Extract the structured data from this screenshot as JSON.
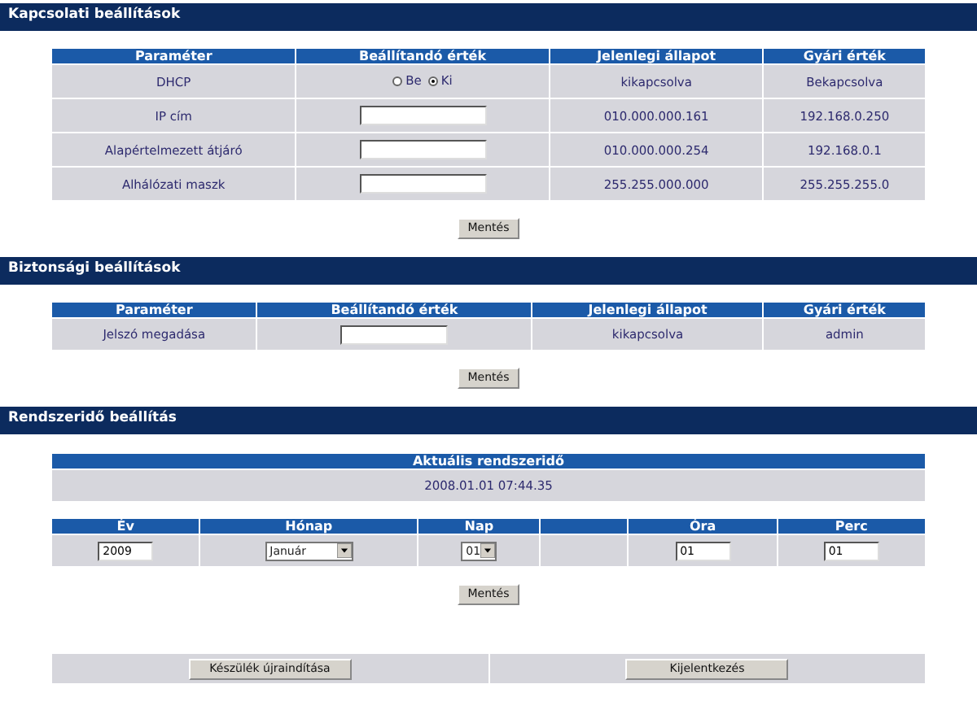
{
  "connection": {
    "title": "Kapcsolati beállítások",
    "columns": [
      "Paraméter",
      "Beállítandó érték",
      "Jelenlegi állapot",
      "Gyári érték"
    ],
    "rows": [
      {
        "parameter": "DHCP",
        "kind": "radio",
        "options": [
          {
            "label": "Be",
            "selected": false
          },
          {
            "label": "Ki",
            "selected": true
          }
        ],
        "current": "kikapcsolva",
        "factory": "Bekapcsolva"
      },
      {
        "parameter": "IP cím",
        "kind": "input",
        "current": "010.000.000.161",
        "factory": "192.168.0.250"
      },
      {
        "parameter": "Alapértelmezett átjáró",
        "kind": "input",
        "current": "010.000.000.254",
        "factory": "192.168.0.1"
      },
      {
        "parameter": "Alhálózati maszk",
        "kind": "input",
        "current": "255.255.000.000",
        "factory": "255.255.255.0"
      }
    ],
    "button": "Mentés"
  },
  "security": {
    "title": "Biztonsági beállítások",
    "columns": [
      "Paraméter",
      "Beállítandó érték",
      "Jelenlegi állapot",
      "Gyári érték"
    ],
    "rows": [
      {
        "parameter": "Jelszó megadása",
        "kind": "input",
        "current": "kikapcsolva",
        "factory": "admin"
      }
    ],
    "button": "Mentés"
  },
  "system_time": {
    "title": "Rendszeridő beállítás",
    "current_heading": "Aktuális rendszeridő",
    "current_value": "2008.01.01 07:44.35",
    "fields": [
      {
        "heading": "Év",
        "kind": "input",
        "value": "2009"
      },
      {
        "heading": "Hónap",
        "kind": "select",
        "value": "Január"
      },
      {
        "heading": "Nap",
        "kind": "select",
        "value": "01"
      },
      {
        "kind": "empty"
      },
      {
        "heading": "Óra",
        "kind": "input",
        "value": "01"
      },
      {
        "heading": "Perc",
        "kind": "input",
        "value": "01"
      }
    ],
    "button": "Mentés"
  },
  "footer_buttons": [
    "Készülék újraindítása",
    "Kijelentkezés"
  ]
}
